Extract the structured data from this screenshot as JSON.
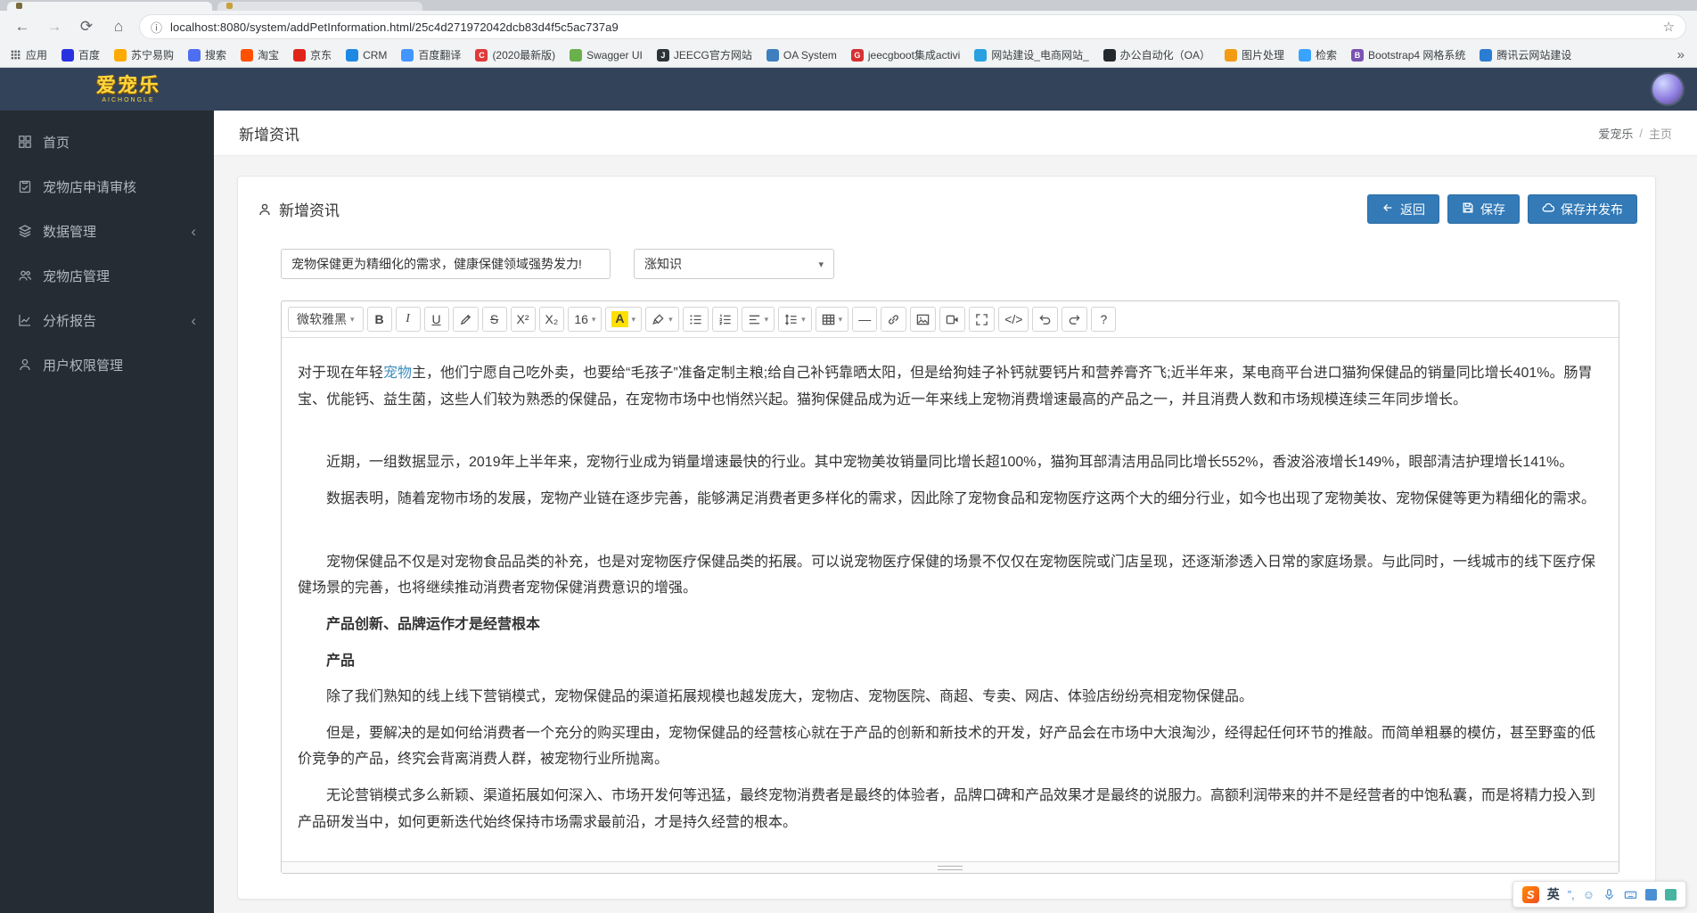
{
  "browser": {
    "url": "localhost:8080/system/addPetInformation.html/25c4d271972042dcb83d4f5c5ac737a9",
    "overflow_chevron": "»",
    "bookmarks": [
      {
        "label": "应用",
        "icon": "apps",
        "color": "#5f6368"
      },
      {
        "label": "百度",
        "color": "#2932e1"
      },
      {
        "label": "苏宁易购",
        "color": "#ffaa00"
      },
      {
        "label": "搜索",
        "color": "#4e6ef2"
      },
      {
        "label": "淘宝",
        "color": "#ff5000"
      },
      {
        "label": "京东",
        "color": "#e1251b"
      },
      {
        "label": "CRM",
        "color": "#1e88e5"
      },
      {
        "label": "百度翻译",
        "color": "#4395ff"
      },
      {
        "label": "(2020最新版)",
        "color": "#e03a3a",
        "letter": "C"
      },
      {
        "label": "Swagger UI",
        "color": "#6ab04c"
      },
      {
        "label": "JEECG官方网站",
        "color": "#2d3436",
        "letter": "J"
      },
      {
        "label": "OA System",
        "color": "#3f7fbf"
      },
      {
        "label": "jeecgboot集成activi",
        "color": "#d63031",
        "letter": "G"
      },
      {
        "label": "网站建设_电商网站_",
        "color": "#29a0e0"
      },
      {
        "label": "办公自动化（OA）",
        "color": "#24292e"
      },
      {
        "label": "图片处理",
        "color": "#f39c12"
      },
      {
        "label": "检索",
        "color": "#3aa3ff"
      },
      {
        "label": "Bootstrap4 网格系统",
        "color": "#7952b3",
        "letter": "B"
      },
      {
        "label": "腾讯云网站建设",
        "color": "#2b7cd3"
      }
    ]
  },
  "header": {
    "logo": "爱宠乐",
    "logo_sub": "AICHONGLE"
  },
  "sidebar": {
    "items": [
      {
        "key": "home",
        "label": "首页",
        "icon": "grid"
      },
      {
        "key": "shop-apply-review",
        "label": "宠物店申请审核",
        "icon": "clipboard"
      },
      {
        "key": "data-management",
        "label": "数据管理",
        "icon": "layers",
        "expandable": true
      },
      {
        "key": "shop-management",
        "label": "宠物店管理",
        "icon": "users"
      },
      {
        "key": "analysis-report",
        "label": "分析报告",
        "icon": "chart",
        "expandable": true
      },
      {
        "key": "user-permission",
        "label": "用户权限管理",
        "icon": "user"
      }
    ]
  },
  "page": {
    "title": "新增资讯",
    "breadcrumb_root": "爱宠乐",
    "breadcrumb_sep": "/",
    "breadcrumb_current": "主页"
  },
  "card": {
    "title": "新增资讯",
    "back_label": "返回",
    "save_label": "保存",
    "publish_label": "保存并发布",
    "title_value": "宠物保健更为精细化的需求，健康保健领域强势发力!",
    "category_value": "涨知识"
  },
  "editor": {
    "toolbar": [
      {
        "name": "font-family-select",
        "text": "微软雅黑",
        "caret": true,
        "class": "wide"
      },
      {
        "name": "bold-button",
        "text": "B",
        "class": "b"
      },
      {
        "name": "italic-button",
        "text": "I",
        "class": "i"
      },
      {
        "name": "underline-button",
        "text": "U",
        "class": "u"
      },
      {
        "name": "pen-button",
        "icon": "pen"
      },
      {
        "name": "strikethrough-button",
        "text": "S",
        "class": "s"
      },
      {
        "name": "superscript-button",
        "text": "X²"
      },
      {
        "name": "subscript-button",
        "text": "X₂"
      },
      {
        "name": "font-size-select",
        "text": "16",
        "caret": true
      },
      {
        "name": "font-color-button",
        "text": "A",
        "class": "colorA",
        "caret": true
      },
      {
        "name": "background-color-button",
        "icon": "brush",
        "caret": true
      },
      {
        "name": "unordered-list-button",
        "icon": "ul"
      },
      {
        "name": "ordered-list-button",
        "icon": "ol"
      },
      {
        "name": "align-select",
        "icon": "align",
        "caret": true
      },
      {
        "name": "line-height-select",
        "icon": "lineheight",
        "caret": true
      },
      {
        "name": "table-button",
        "icon": "table",
        "caret": true
      },
      {
        "name": "hr-button",
        "text": "—"
      },
      {
        "name": "link-button",
        "icon": "link"
      },
      {
        "name": "image-button",
        "icon": "image"
      },
      {
        "name": "video-button",
        "icon": "video"
      },
      {
        "name": "fullscreen-button",
        "icon": "fullscreen"
      },
      {
        "name": "code-button",
        "text": "</>"
      },
      {
        "name": "undo-button",
        "icon": "undo"
      },
      {
        "name": "redo-button",
        "icon": "redo"
      },
      {
        "name": "help-button",
        "text": "?"
      }
    ],
    "content": [
      {
        "style": "p",
        "indent": false,
        "segments": [
          {
            "text": "对于现在年轻"
          },
          {
            "text": "宠物",
            "link": true
          },
          {
            "text": "主，他们宁愿自己吃外卖，也要给“毛孩子”准备定制主粮;给自己补钙靠晒太阳，但是给狗娃子补钙就要钙片和营养膏齐飞;近半年来，某电商平台进口猫狗保健品的销量同比增长401%。肠胃宝、优能钙、益生菌，这些人们较为熟悉的保健品，在宠物市场中也悄然兴起。猫狗保健品成为近一年来线上宠物消费增速最高的产品之一，并且消费人数和市场规模连续三年同步增长。"
          }
        ]
      },
      {
        "style": "blank"
      },
      {
        "style": "p",
        "indent": true,
        "segments": [
          {
            "text": "近期，一组数据显示，2019年上半年来，宠物行业成为销量增速最快的行业。其中宠物美妆销量同比增长超100%，猫狗耳部清洁用品同比增长552%，香波浴液增长149%，眼部清洁护理增长141%。"
          }
        ]
      },
      {
        "style": "p",
        "indent": true,
        "segments": [
          {
            "text": "数据表明，随着宠物市场的发展，宠物产业链在逐步完善，能够满足消费者更多样化的需求，因此除了宠物食品和宠物医疗这两个大的细分行业，如今也出现了宠物美妆、宠物保健等更为精细化的需求。"
          }
        ]
      },
      {
        "style": "blank"
      },
      {
        "style": "p",
        "indent": true,
        "segments": [
          {
            "text": "宠物保健品不仅是对宠物食品品类的补充，也是对宠物医疗保健品类的拓展。可以说宠物医疗保健的场景不仅仅在宠物医院或门店呈现，还逐渐渗透入日常的家庭场景。与此同时，一线城市的线下医疗保健场景的完善，也将继续推动消费者宠物保健消费意识的增强。"
          }
        ]
      },
      {
        "style": "bold",
        "indent": true,
        "segments": [
          {
            "text": "产品创新、品牌运作才是经营根本"
          }
        ]
      },
      {
        "style": "bold",
        "indent": true,
        "segments": [
          {
            "text": "产品"
          }
        ]
      },
      {
        "style": "p",
        "indent": true,
        "segments": [
          {
            "text": "除了我们熟知的线上线下营销模式，宠物保健品的渠道拓展规模也越发庞大，宠物店、宠物医院、商超、专卖、网店、体验店纷纷亮相宠物保健品。"
          }
        ]
      },
      {
        "style": "p",
        "indent": true,
        "segments": [
          {
            "text": "但是，要解决的是如何给消费者一个充分的购买理由，宠物保健品的经营核心就在于产品的创新和新技术的开发，好产品会在市场中大浪淘沙，经得起任何环节的推敲。而简单粗暴的模仿，甚至野蛮的低价竞争的产品，终究会背离消费人群，被宠物行业所抛离。"
          }
        ]
      },
      {
        "style": "p",
        "indent": true,
        "segments": [
          {
            "text": "无论营销模式多么新颖、渠道拓展如何深入、市场开发何等迅猛，最终宠物消费者是最终的体验者，品牌口碑和产品效果才是最终的说服力。高额利润带来的并不是经营者的中饱私囊，而是将精力投入到产品研发当中，如何更新迭代始终保持市场需求最前沿，才是持久经营的根本。"
          }
        ]
      }
    ]
  },
  "ime": {
    "mode": "英",
    "punct": "”,"
  }
}
